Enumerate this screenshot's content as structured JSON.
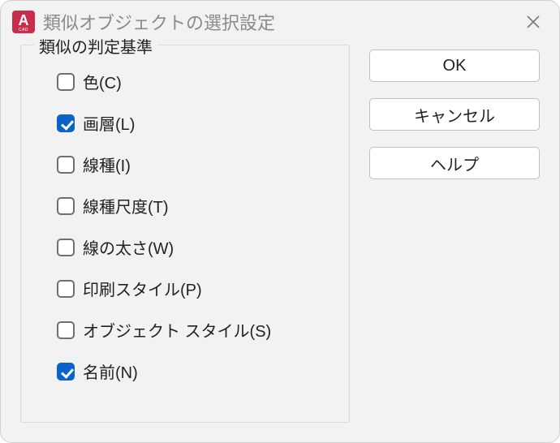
{
  "title": "類似オブジェクトの選択設定",
  "group_label": "類似の判定基準",
  "options": [
    {
      "label": "色(C)",
      "checked": false
    },
    {
      "label": "画層(L)",
      "checked": true
    },
    {
      "label": "線種(I)",
      "checked": false
    },
    {
      "label": "線種尺度(T)",
      "checked": false
    },
    {
      "label": "線の太さ(W)",
      "checked": false
    },
    {
      "label": "印刷スタイル(P)",
      "checked": false
    },
    {
      "label": "オブジェクト スタイル(S)",
      "checked": false
    },
    {
      "label": "名前(N)",
      "checked": true
    }
  ],
  "buttons": {
    "ok": "OK",
    "cancel": "キャンセル",
    "help": "ヘルプ"
  }
}
